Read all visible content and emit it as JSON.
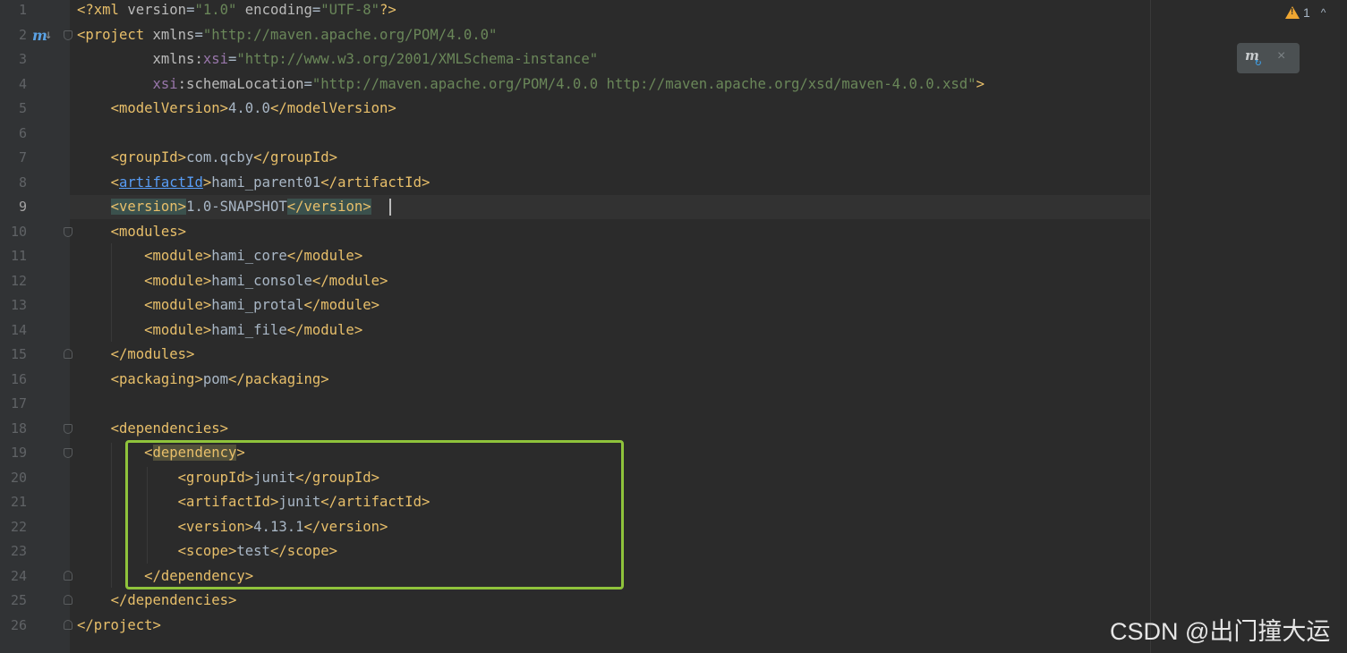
{
  "editor": {
    "line_numbers": [
      "1",
      "2",
      "3",
      "4",
      "5",
      "6",
      "7",
      "8",
      "9",
      "10",
      "11",
      "12",
      "13",
      "14",
      "15",
      "16",
      "17",
      "18",
      "19",
      "20",
      "21",
      "22",
      "23",
      "24",
      "25",
      "26"
    ],
    "current_line": "9",
    "code": {
      "l1": {
        "a": "<?xml ",
        "b": "version",
        "c": "=",
        "d": "\"1.0\"",
        "e": " ",
        "f": "encoding",
        "g": "=",
        "h": "\"UTF-8\"",
        "i": "?>"
      },
      "l2": {
        "a": "<project ",
        "b": "xmlns",
        "c": "=",
        "d": "\"http://maven.apache.org/POM/4.0.0\""
      },
      "l3": {
        "a": "         ",
        "b": "xmlns",
        "c": ":",
        "d": "xsi",
        "e": "=",
        "f": "\"http://www.w3.org/2001/XMLSchema-instance\""
      },
      "l4": {
        "a": "         ",
        "b": "xsi",
        "c": ":schemaLocation",
        "d": "=",
        "e": "\"http://maven.apache.org/POM/4.0.0 http://maven.apache.org/xsd/maven-4.0.0.xsd\"",
        "f": ">"
      },
      "l5": {
        "a": "    ",
        "b": "<modelVersion>",
        "c": "4.0.0",
        "d": "</modelVersion>"
      },
      "l7": {
        "a": "    ",
        "b": "<groupId>",
        "c": "com.qcby",
        "d": "</groupId>"
      },
      "l8": {
        "a": "    ",
        "b": "<",
        "c": "artifactId",
        "d": ">",
        "e": "hami_parent01",
        "f": "</artifactId>"
      },
      "l9": {
        "a": "    ",
        "b": "<version>",
        "c": "1.0-SNAPSHOT",
        "d": "</version>"
      },
      "l10": {
        "a": "    ",
        "b": "<modules>"
      },
      "l11": {
        "a": "        ",
        "b": "<module>",
        "c": "hami_core",
        "d": "</module>"
      },
      "l12": {
        "a": "        ",
        "b": "<module>",
        "c": "hami_console",
        "d": "</module>"
      },
      "l13": {
        "a": "        ",
        "b": "<module>",
        "c": "hami_protal",
        "d": "</module>"
      },
      "l14": {
        "a": "        ",
        "b": "<module>",
        "c": "hami_file",
        "d": "</module>"
      },
      "l15": {
        "a": "    ",
        "b": "</modules>"
      },
      "l16": {
        "a": "    ",
        "b": "<packaging>",
        "c": "pom",
        "d": "</packaging>"
      },
      "l18": {
        "a": "    ",
        "b": "<dependencies>"
      },
      "l19": {
        "a": "        ",
        "b": "<",
        "c": "dependency",
        "d": ">"
      },
      "l20": {
        "a": "            ",
        "b": "<groupId>",
        "c": "junit",
        "d": "</groupId>"
      },
      "l21": {
        "a": "            ",
        "b": "<artifactId>",
        "c": "junit",
        "d": "</artifactId>"
      },
      "l22": {
        "a": "            ",
        "b": "<version>",
        "c": "4.13.1",
        "d": "</version>"
      },
      "l23": {
        "a": "            ",
        "b": "<scope>",
        "c": "test",
        "d": "</scope>"
      },
      "l24": {
        "a": "        ",
        "b": "</dependency>"
      },
      "l25": {
        "a": "    ",
        "b": "</dependencies>"
      },
      "l26": {
        "a": "",
        "b": "</project>"
      }
    }
  },
  "inspections": {
    "warning_count": "1",
    "icon": "warning-triangle-icon",
    "chevron": "^"
  },
  "maven_popup": {
    "m_label": "m",
    "sync_glyph": "↻",
    "close_glyph": "×"
  },
  "gutter_marker": {
    "label": "m",
    "arrow": "↓"
  },
  "watermark": "CSDN @出门撞大运",
  "colors": {
    "background": "#2b2b2b",
    "tag": "#e8bf6a",
    "string": "#6a8759",
    "namespace": "#9876aa",
    "highlight_box": "#8fc33b"
  }
}
